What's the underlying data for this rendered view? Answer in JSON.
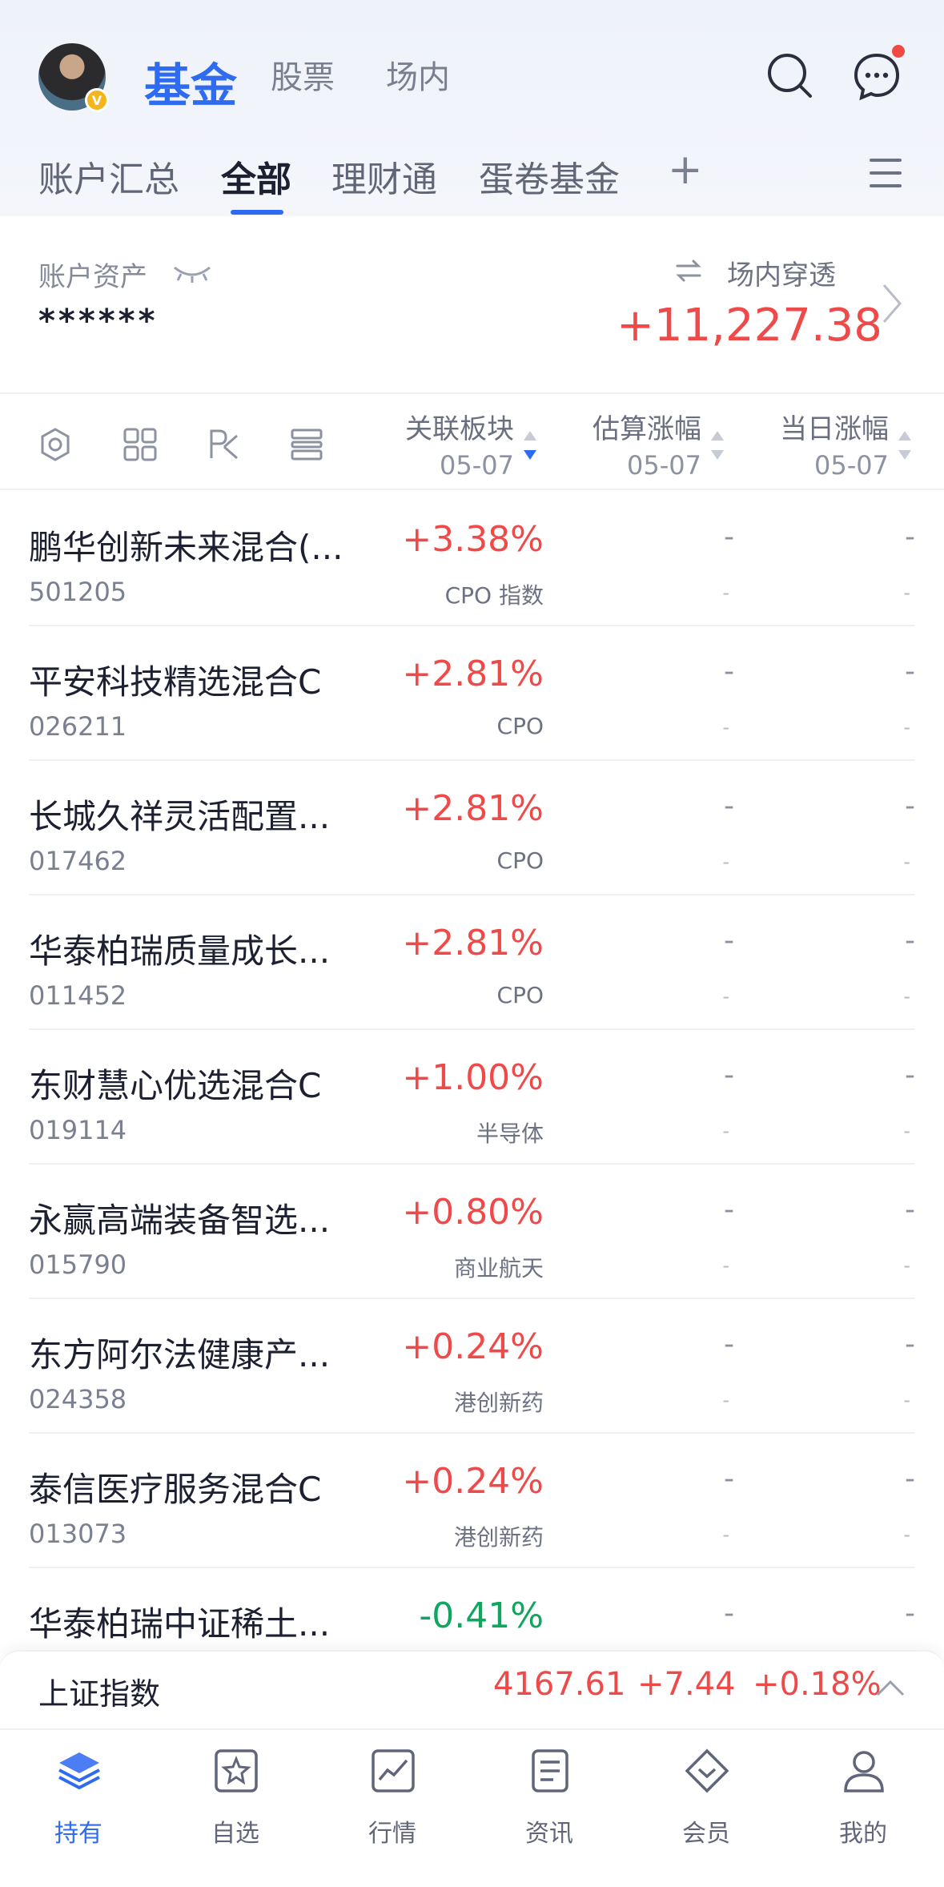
{
  "header": {
    "top_tabs": [
      "基金",
      "股票",
      "场内"
    ],
    "sub_tabs": [
      "账户汇总",
      "全部",
      "理财通",
      "蛋卷基金"
    ],
    "avatar_badge": "V",
    "add_tab": "+"
  },
  "assets": {
    "label": "账户资产",
    "value": "******",
    "penetration_label": "场内穿透",
    "penetration_value": "+11,227.38"
  },
  "columns": [
    {
      "title": "关联板块",
      "date": "05-07"
    },
    {
      "title": "估算涨幅",
      "date": "05-07"
    },
    {
      "title": "当日涨幅",
      "date": "05-07"
    }
  ],
  "funds": [
    {
      "name": "鹏华创新未来混合(...",
      "code": "501205",
      "change": "+3.38%",
      "sector": "CPO 指数",
      "est": "-",
      "est_sub": "-",
      "day": "-",
      "day_sub": "-"
    },
    {
      "name": "平安科技精选混合C",
      "code": "026211",
      "change": "+2.81%",
      "sector": "CPO",
      "est": "-",
      "est_sub": "-",
      "day": "-",
      "day_sub": "-"
    },
    {
      "name": "长城久祥灵活配置...",
      "code": "017462",
      "change": "+2.81%",
      "sector": "CPO",
      "est": "-",
      "est_sub": "-",
      "day": "-",
      "day_sub": "-"
    },
    {
      "name": "华泰柏瑞质量成长...",
      "code": "011452",
      "change": "+2.81%",
      "sector": "CPO",
      "est": "-",
      "est_sub": "-",
      "day": "-",
      "day_sub": "-"
    },
    {
      "name": "东财慧心优选混合C",
      "code": "019114",
      "change": "+1.00%",
      "sector": "半导体",
      "est": "-",
      "est_sub": "-",
      "day": "-",
      "day_sub": "-"
    },
    {
      "name": "永赢高端装备智选...",
      "code": "015790",
      "change": "+0.80%",
      "sector": "商业航天",
      "est": "-",
      "est_sub": "-",
      "day": "-",
      "day_sub": "-"
    },
    {
      "name": "东方阿尔法健康产...",
      "code": "024358",
      "change": "+0.24%",
      "sector": "港创新药",
      "est": "-",
      "est_sub": "-",
      "day": "-",
      "day_sub": "-"
    },
    {
      "name": "泰信医疗服务混合C",
      "code": "013073",
      "change": "+0.24%",
      "sector": "港创新药",
      "est": "-",
      "est_sub": "-",
      "day": "-",
      "day_sub": "-"
    },
    {
      "name": "华泰柏瑞中证稀土...",
      "code": "",
      "change": "-0.41%",
      "sector": "",
      "est": "-",
      "est_sub": "",
      "day": "-",
      "day_sub": ""
    }
  ],
  "index_bar": {
    "name": "上证指数",
    "value": "4167.61",
    "change": "+7.44",
    "pct": "+0.18%"
  },
  "bottom_nav": [
    "持有",
    "自选",
    "行情",
    "资讯",
    "会员",
    "我的"
  ],
  "colors": {
    "accent": "#2f6bf0",
    "up": "#ef4a4a",
    "down": "#0fa760"
  }
}
